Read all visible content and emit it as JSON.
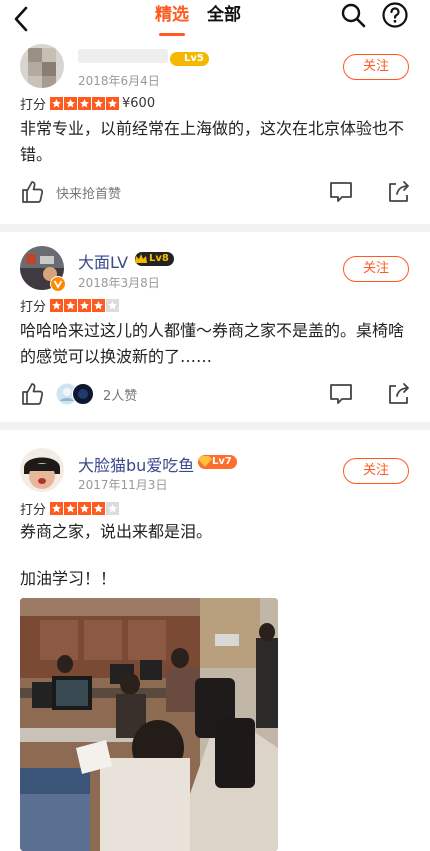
{
  "nav": {
    "tab_selected": "精选",
    "tab_all": "全部",
    "back_icon": "chevron-left-icon",
    "search_icon": "search-icon",
    "help_icon": "help-circle-icon"
  },
  "reviews": [
    {
      "name": "",
      "level": "Lv5",
      "date": "2018年6月4日",
      "follow": "关注",
      "rating_label": "打分",
      "stars": 5,
      "price": "¥600",
      "text": "非常专业，以前经常在上海做的，这次在北京体验也不错。",
      "like_text": "快来抢首赞"
    },
    {
      "name": "大面LV",
      "level": "Lv8",
      "date": "2018年3月8日",
      "follow": "关注",
      "rating_label": "打分",
      "stars": 4,
      "price": "",
      "text": "哈哈哈来过这儿的人都懂～券商之家不是盖的。桌椅啥的感觉可以换波新的了……",
      "like_text": "2人赞"
    },
    {
      "name": "大脸猫bu爱吃鱼",
      "level": "Lv7",
      "date": "2017年11月3日",
      "follow": "关注",
      "rating_label": "打分",
      "stars": 4,
      "price": "",
      "text_line1": "券商之家，说出来都是泪。",
      "text_line2": "加油学习！！"
    }
  ],
  "colors": {
    "accent": "#ff5a1f",
    "name": "#3a4a8a",
    "separator": "#f2f2f2"
  }
}
